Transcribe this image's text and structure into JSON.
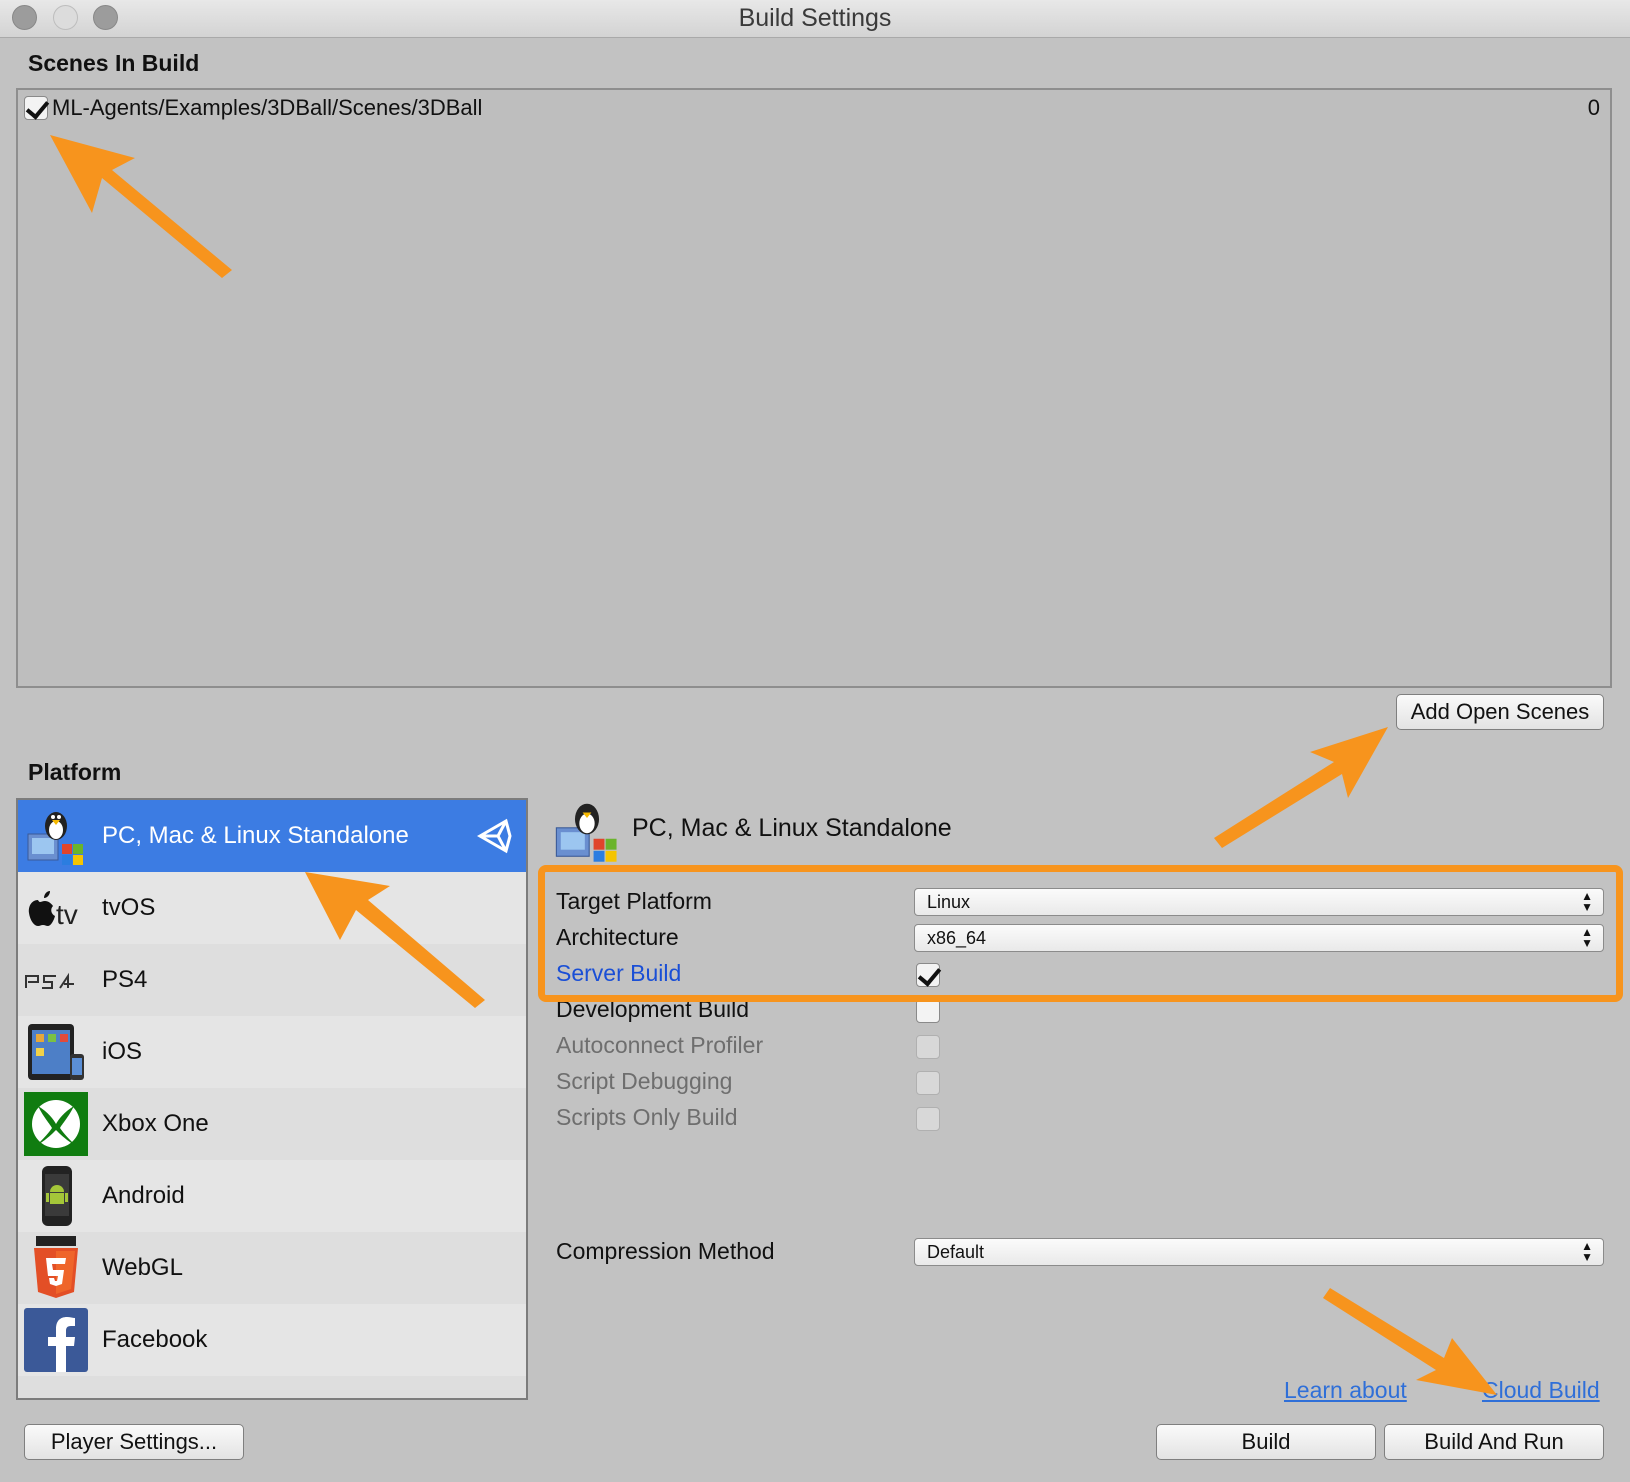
{
  "window": {
    "title": "Build Settings"
  },
  "scenes": {
    "title": "Scenes In Build",
    "items": [
      {
        "path": "ML-Agents/Examples/3DBall/Scenes/3DBall",
        "index": "0",
        "checked": true
      }
    ],
    "add_button": "Add Open Scenes"
  },
  "platform": {
    "title": "Platform",
    "items": [
      {
        "label": "PC, Mac & Linux Standalone",
        "icon": "tux-standalone-icon",
        "selected": true
      },
      {
        "label": "tvOS",
        "icon": "apple-tv-icon"
      },
      {
        "label": "PS4",
        "icon": "ps4-icon"
      },
      {
        "label": "iOS",
        "icon": "ipad-icon"
      },
      {
        "label": "Xbox One",
        "icon": "xbox-icon"
      },
      {
        "label": "Android",
        "icon": "android-icon"
      },
      {
        "label": "WebGL",
        "icon": "html5-icon"
      },
      {
        "label": "Facebook",
        "icon": "facebook-icon"
      }
    ]
  },
  "details": {
    "title": "PC, Mac & Linux Standalone",
    "target_platform": {
      "label": "Target Platform",
      "value": "Linux"
    },
    "architecture": {
      "label": "Architecture",
      "value": "x86_64"
    },
    "server_build": {
      "label": "Server Build",
      "checked": true
    },
    "development_build": {
      "label": "Development Build",
      "checked": false
    },
    "autoconnect_profiler": {
      "label": "Autoconnect Profiler",
      "checked": false
    },
    "script_debugging": {
      "label": "Script Debugging",
      "checked": false
    },
    "scripts_only_build": {
      "label": "Scripts Only Build",
      "checked": false
    },
    "compression": {
      "label": "Compression Method",
      "value": "Default"
    }
  },
  "footer": {
    "learn_link_start": "Learn about ",
    "learn_link_end": "Cloud Build",
    "player_settings": "Player Settings...",
    "build": "Build",
    "build_and_run": "Build And Run"
  },
  "colors": {
    "accent_arrow": "#f7941d",
    "selection": "#3c7ce3",
    "link": "#1a4fd6"
  }
}
